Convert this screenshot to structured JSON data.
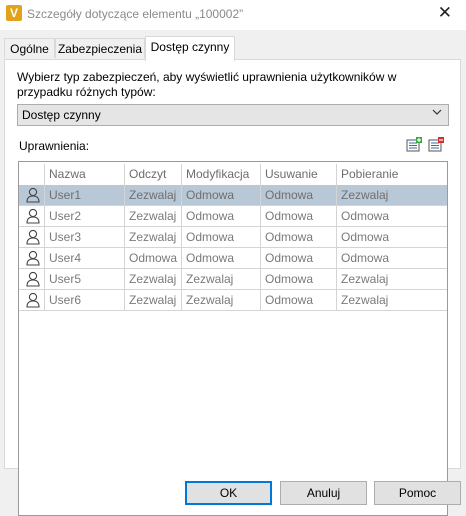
{
  "window": {
    "title": "Szczegóły dotyczące elementu „100002”",
    "app_icon_glyph": "V",
    "close_glyph": "✕"
  },
  "tabs": [
    {
      "label": "Ogólne"
    },
    {
      "label": "Zabezpieczenia"
    },
    {
      "label": "Dostęp czynny",
      "active": true
    }
  ],
  "panel": {
    "instruction": "Wybierz typ zabezpieczeń, aby wyświetlić uprawnienia użytkowników w przypadku różnych typów:",
    "security_type_value": "Dostęp czynny",
    "permissions_label": "Uprawnienia:"
  },
  "grid": {
    "columns": [
      "Nazwa",
      "Odczyt",
      "Modyfikacja",
      "Usuwanie",
      "Pobieranie"
    ],
    "rows": [
      [
        "User1",
        "Zezwalaj",
        "Odmowa",
        "Odmowa",
        "Zezwalaj"
      ],
      [
        "User2",
        "Zezwalaj",
        "Odmowa",
        "Odmowa",
        "Odmowa"
      ],
      [
        "User3",
        "Zezwalaj",
        "Odmowa",
        "Odmowa",
        "Odmowa"
      ],
      [
        "User4",
        "Odmowa",
        "Odmowa",
        "Odmowa",
        "Odmowa"
      ],
      [
        "User5",
        "Zezwalaj",
        "Zezwalaj",
        "Odmowa",
        "Zezwalaj"
      ],
      [
        "User6",
        "Zezwalaj",
        "Zezwalaj",
        "Odmowa",
        "Zezwalaj"
      ]
    ],
    "selected_row": 0
  },
  "buttons": {
    "ok": "OK",
    "cancel": "Anuluj",
    "help": "Pomoc"
  },
  "colors": {
    "accent": "#0078d7",
    "selection": "#b9c8d6",
    "app_icon": "#e2a21a"
  }
}
